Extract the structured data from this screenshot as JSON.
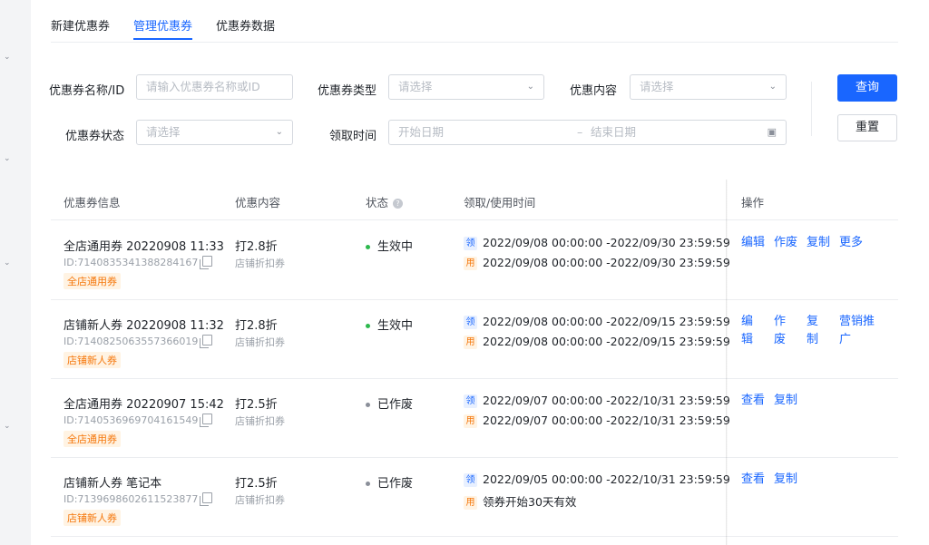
{
  "tabs": [
    "新建优惠券",
    "管理优惠券",
    "优惠券数据"
  ],
  "filters": {
    "name_label": "优惠券名称/ID",
    "name_placeholder": "请输入优惠券名称或ID",
    "type_label": "优惠券类型",
    "type_placeholder": "请选择",
    "content_label": "优惠内容",
    "content_placeholder": "请选择",
    "status_label": "优惠券状态",
    "status_placeholder": "请选择",
    "time_label": "领取时间",
    "start_placeholder": "开始日期",
    "range_sep": "–",
    "end_placeholder": "结束日期",
    "search_button": "查询",
    "reset_button": "重置"
  },
  "table": {
    "headers": [
      "优惠券信息",
      "优惠内容",
      "状态",
      "领取/使用时间",
      "操作"
    ],
    "get_badge": "领",
    "use_badge": "用",
    "rows": [
      {
        "name": "全店通用券 20220908 11:33",
        "id": "ID:7140835341388284167",
        "tag": "全店通用券",
        "content": "打2.8折",
        "content_sub": "店铺折扣券",
        "status": "生效中",
        "get_time": "2022/09/08 00:00:00 -2022/09/30 23:59:59",
        "use_time": "2022/09/08 00:00:00 -2022/09/30 23:59:59",
        "ops": [
          "编辑",
          "作废",
          "复制",
          "更多"
        ]
      },
      {
        "name": "店铺新人券 20220908 11:32",
        "id": "ID:7140825063557366019",
        "tag": "店铺新人券",
        "content": "打2.8折",
        "content_sub": "店铺折扣券",
        "status": "生效中",
        "get_time": "2022/09/08 00:00:00 -2022/09/15 23:59:59",
        "use_time": "2022/09/08 00:00:00 -2022/09/15 23:59:59",
        "ops": [
          "编辑",
          "作废",
          "复制",
          "营销推广"
        ]
      },
      {
        "name": "全店通用券 20220907 15:42",
        "id": "ID:7140536969704161549",
        "tag": "全店通用券",
        "content": "打2.5折",
        "content_sub": "店铺折扣券",
        "status": "已作废",
        "get_time": "2022/09/07 00:00:00 -2022/10/31 23:59:59",
        "use_time": "2022/09/07 00:00:00 -2022/10/31 23:59:59",
        "ops": [
          "查看",
          "复制"
        ]
      },
      {
        "name": "店铺新人券 笔记本",
        "id": "ID:7139698602611523877",
        "tag": "店铺新人券",
        "content": "打2.5折",
        "content_sub": "店铺折扣券",
        "status": "已作废",
        "get_time": "2022/09/05 00:00:00 -2022/10/31 23:59:59",
        "use_time": "领券开始30天有效",
        "ops": [
          "查看",
          "复制"
        ]
      }
    ]
  },
  "colors": {
    "primary": "#1966ff",
    "active_status": "#2db84d",
    "void_status": "#8a8f99",
    "tag_orange": "#f5770b"
  }
}
